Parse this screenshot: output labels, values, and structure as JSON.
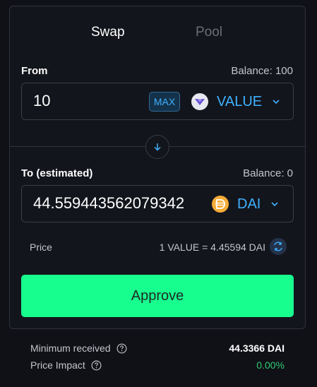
{
  "tabs": [
    {
      "label": "Swap",
      "active": true
    },
    {
      "label": "Pool",
      "active": false
    }
  ],
  "from": {
    "label": "From",
    "balance": "Balance: 100",
    "amount": "10",
    "max_label": "MAX",
    "token": "VALUE",
    "token_icon": "value-token-icon"
  },
  "to": {
    "label": "To (estimated)",
    "balance": "Balance: 0",
    "amount": "44.559443562079342",
    "token": "DAI",
    "token_icon": "dai-token-icon"
  },
  "price": {
    "label": "Price",
    "value": "1 VALUE = 4.45594 DAI"
  },
  "approve_label": "Approve",
  "details": {
    "min_received_label": "Minimum received",
    "min_received_value": "44.3366 DAI",
    "price_impact_label": "Price Impact",
    "price_impact_value": "0.00%"
  },
  "colors": {
    "accent": "#3fb1ff",
    "approve_bg": "#17fd8e",
    "positive": "#2ecc71"
  }
}
